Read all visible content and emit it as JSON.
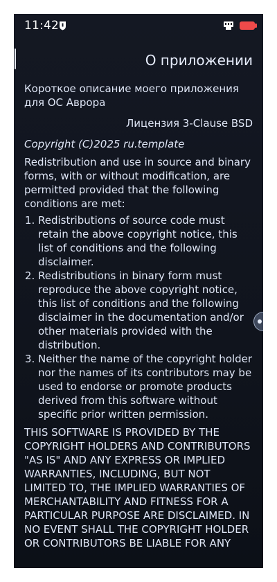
{
  "statusbar": {
    "time": "11:42",
    "notification_icon": "shield-notification-icon",
    "ethernet_icon": "ethernet-icon",
    "battery_icon": "battery-low-icon",
    "battery_color": "#f04a4a"
  },
  "page": {
    "title": "О приложении",
    "description": "Короткое описание моего приложения для ОС Аврора",
    "license_title": "Лицензия 3-Clause BSD",
    "copyright": "Copyright (C)2025 ru.template",
    "intro": "Redistribution and use in source and binary forms, with or without modification, are permitted provided that the following conditions are met:",
    "conditions": [
      "Redistributions of source code must retain the above copyright notice, this list of conditions and the following disclaimer.",
      "Redistributions in binary form must reproduce the above copyright notice, this list of conditions and the following disclaimer in the documentation and/or other materials provided with the distribution.",
      "Neither the name of the copyright holder nor the names of its contributors may be used to endorse or promote products derived from this software without specific prior written permission."
    ],
    "disclaimer": "THIS SOFTWARE IS PROVIDED BY THE COPYRIGHT HOLDERS AND CONTRIBUTORS \"AS IS\" AND ANY EXPRESS OR IMPLIED WARRANTIES, INCLUDING, BUT NOT LIMITED TO, THE IMPLIED WARRANTIES OF MERCHANTABILITY AND FITNESS FOR A PARTICULAR PURPOSE ARE DISCLAIMED. IN NO EVENT SHALL THE COPYRIGHT HOLDER OR CONTRIBUTORS BE LIABLE FOR ANY"
  },
  "colors": {
    "background": "#161a24",
    "text": "#dfe6f6"
  }
}
